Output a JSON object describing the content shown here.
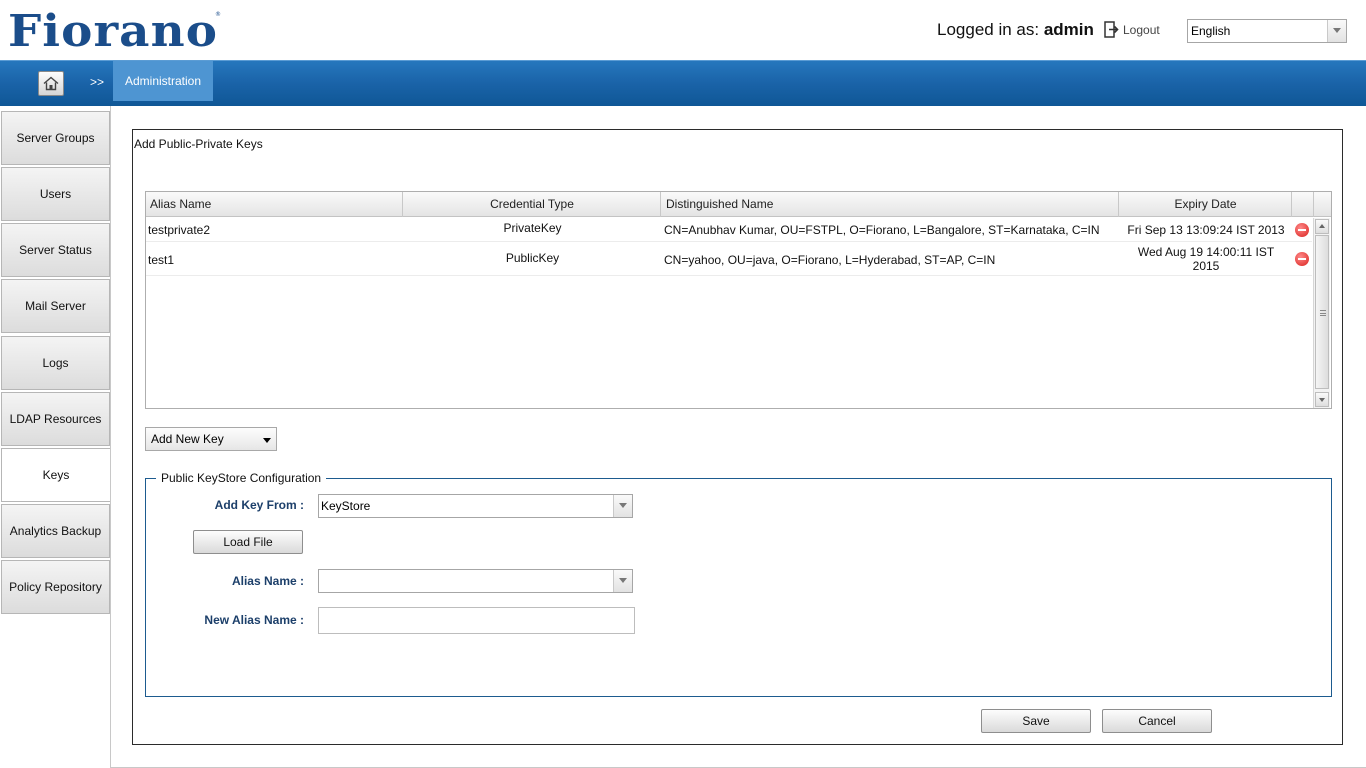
{
  "header": {
    "logo_text": "Fiorano",
    "logged_in_prefix": "Logged in as:",
    "user": "admin",
    "logout_label": "Logout",
    "language": "English"
  },
  "navbar": {
    "separator": ">>",
    "current": "Administration"
  },
  "sidebar": {
    "items": [
      {
        "label": "Server Groups"
      },
      {
        "label": "Users"
      },
      {
        "label": "Server Status"
      },
      {
        "label": "Mail Server"
      },
      {
        "label": "Logs"
      },
      {
        "label": "LDAP Resources"
      },
      {
        "label": "Keys"
      },
      {
        "label": "Analytics Backup"
      },
      {
        "label": "Policy Repository"
      }
    ],
    "active": "Keys"
  },
  "panel": {
    "title": "Add Public-Private Keys"
  },
  "table": {
    "columns": [
      "Alias Name",
      "Credential Type",
      "Distinguished Name",
      "Expiry Date"
    ],
    "rows": [
      {
        "alias": "testprivate2",
        "type": "PrivateKey",
        "dn": "CN=Anubhav Kumar, OU=FSTPL, O=Fiorano, L=Bangalore, ST=Karnataka, C=IN",
        "expiry_line1": "Fri Sep 13 13:09:24 IST 2013",
        "expiry_line2": ""
      },
      {
        "alias": "test1",
        "type": "PublicKey",
        "dn": "CN=yahoo, OU=java, O=Fiorano, L=Hyderabad, ST=AP, C=IN",
        "expiry_line1": "Wed Aug 19 14:00:11 IST",
        "expiry_line2": "2015"
      }
    ]
  },
  "add_key_menu": {
    "label": "Add New Key"
  },
  "config": {
    "legend": "Public KeyStore Configuration",
    "add_key_from_label": "Add Key From :",
    "add_key_from_value": "KeyStore",
    "load_file_label": "Load File",
    "alias_name_label": "Alias Name :",
    "alias_name_value": "",
    "new_alias_label": "New Alias Name :",
    "new_alias_value": ""
  },
  "actions": {
    "save": "Save",
    "cancel": "Cancel"
  },
  "colors": {
    "nav_blue": "#1a63a8",
    "active_crumb": "#4e95d2",
    "label_blue": "#1c3f6a",
    "logo_blue": "#1b4d8a"
  }
}
